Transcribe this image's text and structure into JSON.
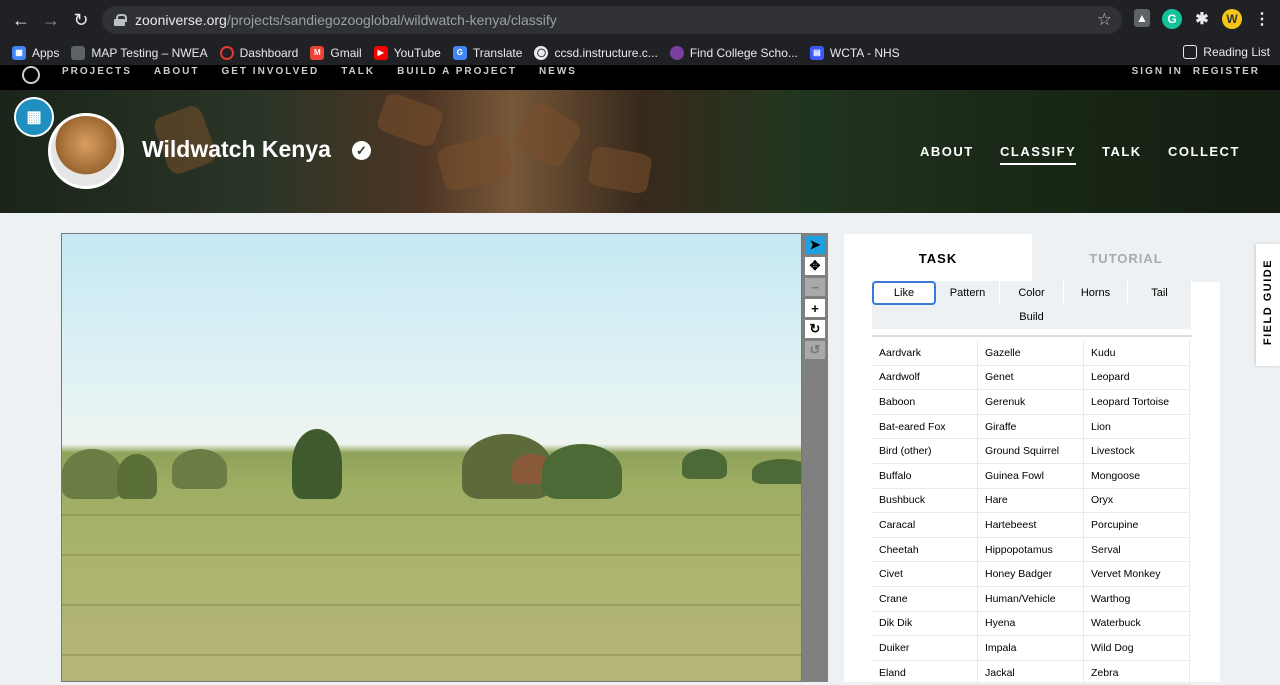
{
  "browser": {
    "url_host": "zooniverse.org",
    "url_path": "/projects/sandiegozooglobal/wildwatch-kenya/classify",
    "bookmarks": [
      {
        "label": "Apps",
        "icon": "apps-grid-icon",
        "color": "#4285f4"
      },
      {
        "label": "MAP Testing – NWEA",
        "icon": "folder-icon",
        "color": "#e8eaed"
      },
      {
        "label": "Dashboard",
        "icon": "dashboard-icon",
        "color": "#e53935"
      },
      {
        "label": "Gmail",
        "icon": "gmail-icon",
        "color": "#ea4335"
      },
      {
        "label": "YouTube",
        "icon": "youtube-icon",
        "color": "#ff0000"
      },
      {
        "label": "Translate",
        "icon": "translate-icon",
        "color": "#4285f4"
      },
      {
        "label": "ccsd.instructure.c...",
        "icon": "globe-icon",
        "color": "#e8eaed"
      },
      {
        "label": "Find College Scho...",
        "icon": "college-icon",
        "color": "#7b3fa0"
      },
      {
        "label": "WCTA - NHS",
        "icon": "wcta-icon",
        "color": "#3d5afe"
      }
    ],
    "reading_list": "Reading List"
  },
  "zoo_nav": {
    "links": [
      "PROJECTS",
      "ABOUT",
      "GET INVOLVED",
      "TALK",
      "BUILD A PROJECT",
      "NEWS"
    ],
    "sign_in": "SIGN IN",
    "register": "REGISTER"
  },
  "project": {
    "title": "Wildwatch Kenya",
    "nav": [
      "ABOUT",
      "CLASSIFY",
      "TALK",
      "COLLECT"
    ],
    "active_nav": "CLASSIFY"
  },
  "task": {
    "tabs": [
      "TASK",
      "TUTORIAL"
    ],
    "active_tab": "TASK",
    "filters": [
      "Like",
      "Pattern",
      "Color",
      "Horns",
      "Tail",
      "Build"
    ],
    "active_filter": "Like",
    "species_columns": [
      [
        "Aardvark",
        "Aardwolf",
        "Baboon",
        "Bat-eared Fox",
        "Bird (other)",
        "Buffalo",
        "Bushbuck",
        "Caracal",
        "Cheetah",
        "Civet",
        "Crane",
        "Dik Dik",
        "Duiker",
        "Eland"
      ],
      [
        "Gazelle",
        "Genet",
        "Gerenuk",
        "Giraffe",
        "Ground Squirrel",
        "Guinea Fowl",
        "Hare",
        "Hartebeest",
        "Hippopotamus",
        "Honey Badger",
        "Human/Vehicle",
        "Hyena",
        "Impala",
        "Jackal"
      ],
      [
        "Kudu",
        "Leopard",
        "Leopard Tortoise",
        "Lion",
        "Livestock",
        "Mongoose",
        "Oryx",
        "Porcupine",
        "Serval",
        "Vervet Monkey",
        "Warthog",
        "Waterbuck",
        "Wild Dog",
        "Zebra"
      ]
    ]
  },
  "field_guide": "FIELD GUIDE",
  "colors": {
    "accent_blue": "#3a7bd5",
    "tool_active": "#1fa0e0"
  }
}
